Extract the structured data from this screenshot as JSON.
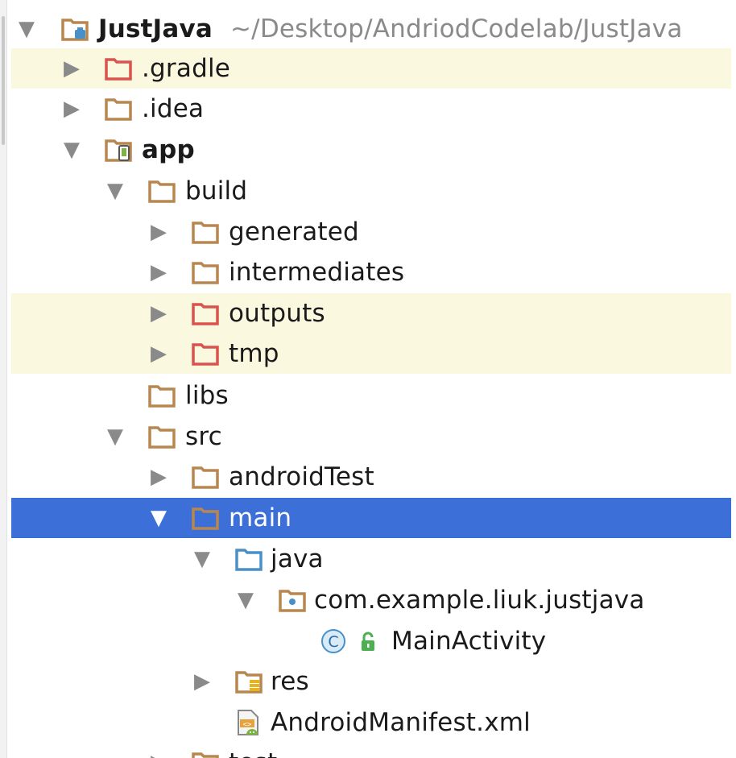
{
  "tree": {
    "root": {
      "name": "JustJava",
      "path": "~/Desktop/AndriodCodelab/JustJava"
    },
    "gradle": ".gradle",
    "idea": ".idea",
    "app": "app",
    "build": "build",
    "generated": "generated",
    "intermediates": "intermediates",
    "outputs": "outputs",
    "tmp": "tmp",
    "libs": "libs",
    "src": "src",
    "androidTest": "androidTest",
    "main": "main",
    "java": "java",
    "package": "com.example.liuk.justjava",
    "main_activity": "MainActivity",
    "class_badge": "C",
    "res": "res",
    "manifest": "AndroidManifest.xml",
    "test": "test"
  },
  "colors": {
    "folder": "#b8864f",
    "excluded_folder": "#d9534f",
    "source_folder": "#4a90c8",
    "selection": "#3d6fd9",
    "highlight_row": "#fbf8e0"
  },
  "icons": {
    "project": "project-folder-icon",
    "module": "android-module-icon",
    "folder": "folder-icon",
    "excluded": "excluded-folder-icon",
    "source": "source-folder-icon",
    "package": "package-icon",
    "class": "class-icon",
    "resources": "resources-folder-icon",
    "manifest": "manifest-file-icon"
  }
}
